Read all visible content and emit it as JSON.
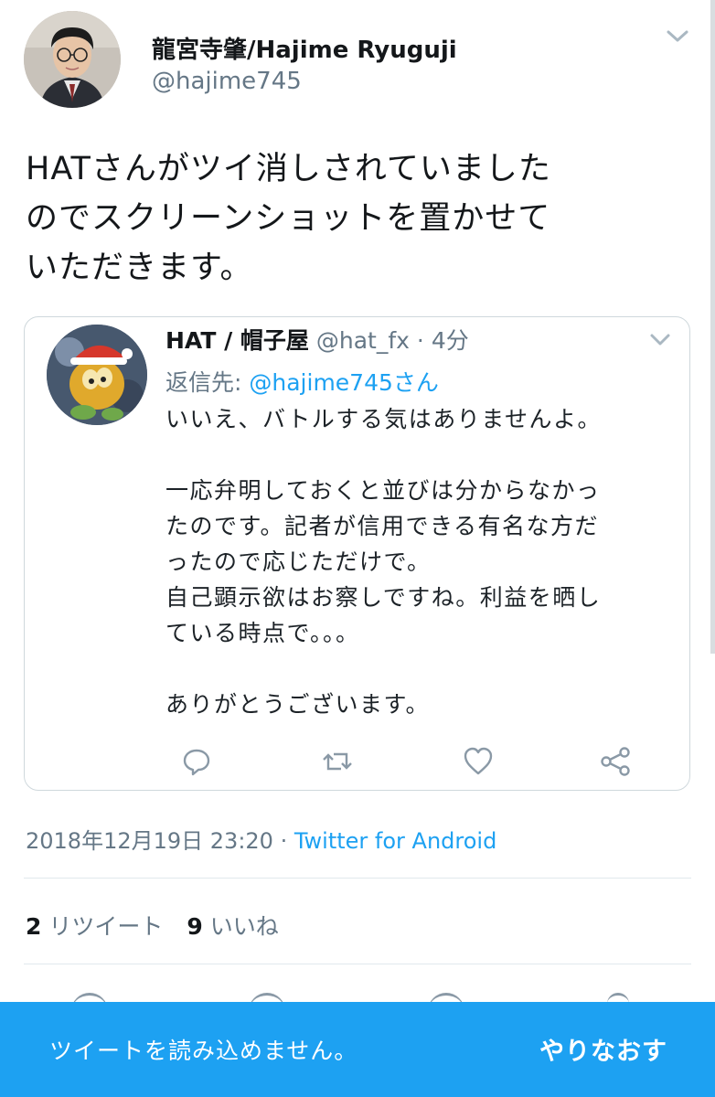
{
  "tweet": {
    "author": {
      "display_name": "龍宮寺肇/Hajime Ryuguji",
      "handle": "@hajime745"
    },
    "text_lines": [
      "HATさんがツイ消しされていました",
      "のでスクリーンショットを置かせて",
      "いただきます。"
    ],
    "quoted_screenshot": {
      "name": "HAT / 帽子屋",
      "handle": "@hat_fx",
      "separator": "·",
      "time": "4分",
      "reply_prefix": "返信先:",
      "reply_mention": "@hajime745さん",
      "body_lines": [
        "いいえ、バトルする気はありませんよ。",
        "",
        "一応弁明しておくと並びは分からなかっ",
        "たのです。記者が信用できる有名な方だ",
        "ったので応じただけで。",
        "自己顕示欲はお察しですね。利益を晒し",
        "ている時点で。。。",
        "",
        "ありがとうございます。"
      ],
      "actions": [
        "reply-icon",
        "retweet-icon",
        "like-icon",
        "share-icon"
      ]
    },
    "timestamp": "2018年12月19日 23:20",
    "timestamp_separator": " · ",
    "client": "Twitter for Android",
    "stats": {
      "retweet_count": "2",
      "retweet_label": "リツイート",
      "like_count": "9",
      "like_label": "いいね"
    }
  },
  "snackbar": {
    "message": "ツイートを読み込めません。",
    "action": "やりなおす"
  },
  "colors": {
    "accent": "#1da1f2",
    "secondary_text": "#657786",
    "border": "#e1e8ed"
  }
}
